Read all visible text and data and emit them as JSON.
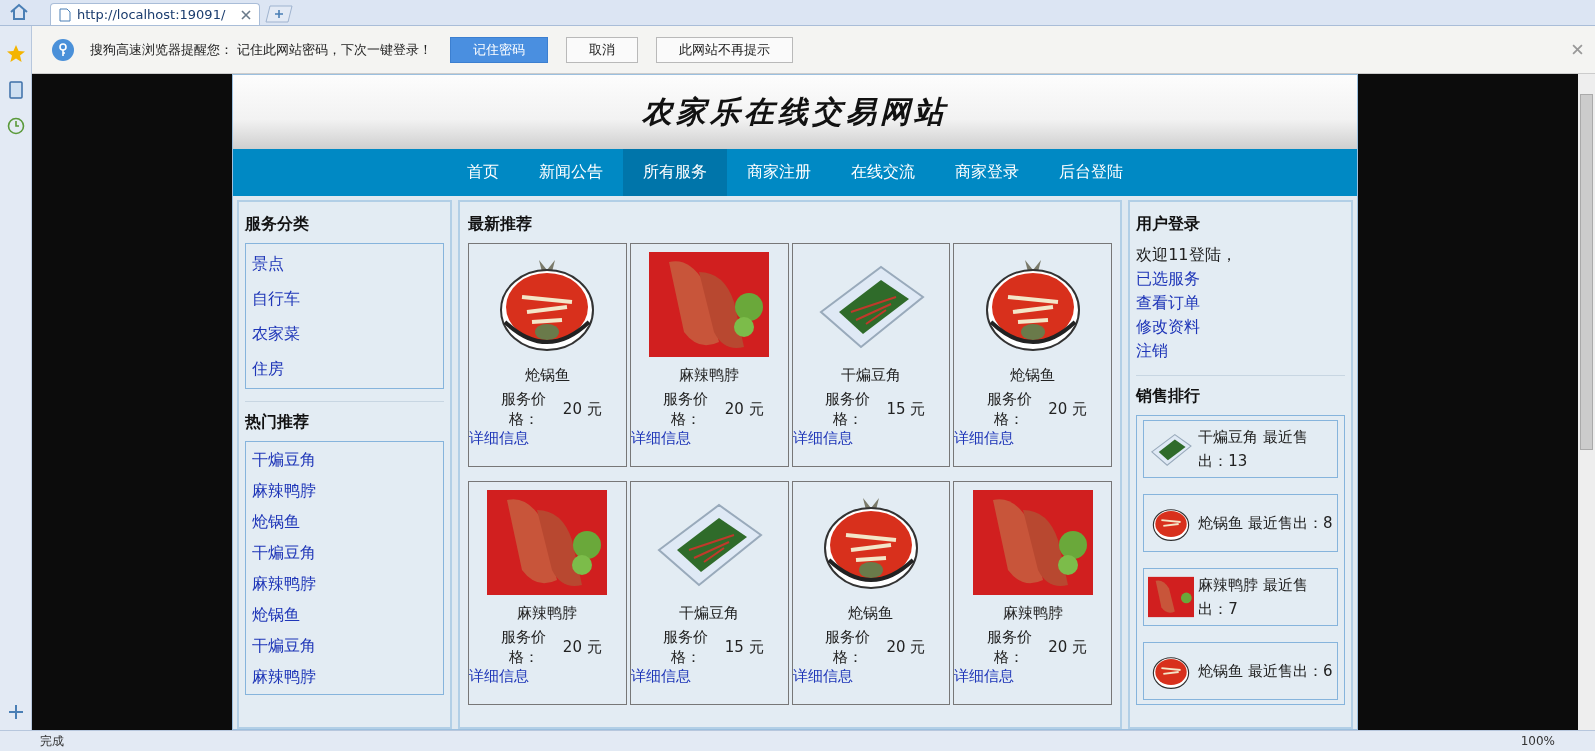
{
  "browser": {
    "tab": {
      "title": "http://localhost:19091/",
      "selected": true
    },
    "notice": {
      "text": "搜狗高速浏览器提醒您： 记住此网站密码，下次一键登录！",
      "buttons": [
        {
          "label": "记住密码",
          "primary": true
        },
        {
          "label": "取消",
          "primary": false
        },
        {
          "label": "此网站不再提示",
          "primary": false
        }
      ]
    },
    "status_bar": {
      "text": "完成",
      "zoom": "100%"
    }
  },
  "site": {
    "title": "农家乐在线交易网站",
    "nav": [
      {
        "label": "首页",
        "selected": false
      },
      {
        "label": "新闻公告",
        "selected": false
      },
      {
        "label": "所有服务",
        "selected": true
      },
      {
        "label": "商家注册",
        "selected": false
      },
      {
        "label": "在线交流",
        "selected": false
      },
      {
        "label": "商家登录",
        "selected": false
      },
      {
        "label": "后台登陆",
        "selected": false
      }
    ],
    "categories": {
      "title": "服务分类",
      "items": [
        "景点",
        "自行车",
        "农家菜",
        "住房"
      ]
    },
    "hot": {
      "title": "热门推荐",
      "items": [
        "干煸豆角",
        "麻辣鸭脖",
        "炝锅鱼",
        "干煸豆角",
        "麻辣鸭脖",
        "炝锅鱼",
        "干煸豆角",
        "麻辣鸭脖"
      ]
    },
    "latest": {
      "title": "最新推荐",
      "products": [
        {
          "name": "炝锅鱼",
          "kind": "fish",
          "price_label": "服务价格：",
          "price": "20 元",
          "link": "详细信息"
        },
        {
          "name": "麻辣鸭脖",
          "kind": "duck",
          "price_label": "服务价格：",
          "price": "20 元",
          "link": "详细信息"
        },
        {
          "name": "干煸豆角",
          "kind": "beans",
          "price_label": "服务价格：",
          "price": "15 元",
          "link": "详细信息"
        },
        {
          "name": "炝锅鱼",
          "kind": "fish",
          "price_label": "服务价格：",
          "price": "20 元",
          "link": "详细信息"
        },
        {
          "name": "麻辣鸭脖",
          "kind": "duck",
          "price_label": "服务价格：",
          "price": "20 元",
          "link": "详细信息"
        },
        {
          "name": "干煸豆角",
          "kind": "beans",
          "price_label": "服务价格：",
          "price": "15 元",
          "link": "详细信息"
        },
        {
          "name": "炝锅鱼",
          "kind": "fish",
          "price_label": "服务价格：",
          "price": "20 元",
          "link": "详细信息"
        },
        {
          "name": "麻辣鸭脖",
          "kind": "duck",
          "price_label": "服务价格：",
          "price": "20 元",
          "link": "详细信息"
        }
      ]
    },
    "login": {
      "title": "用户登录",
      "welcome": "欢迎11登陆，",
      "links": [
        "已选服务",
        "查看订单",
        "修改资料",
        "注销"
      ]
    },
    "ranking": {
      "title": "销售排行",
      "items": [
        {
          "kind": "beans",
          "text": "干煸豆角 最近售出：13"
        },
        {
          "kind": "fish",
          "text": "炝锅鱼 最近售出：8"
        },
        {
          "kind": "duck",
          "text": "麻辣鸭脖 最近售出：7"
        },
        {
          "kind": "fish",
          "text": "炝锅鱼 最近售出：6"
        }
      ]
    }
  }
}
